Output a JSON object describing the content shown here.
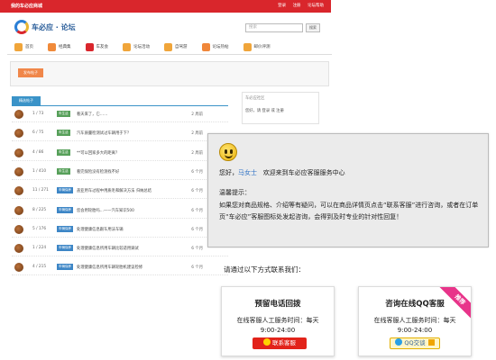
{
  "topbar": {
    "site_title": "我的车必应商城",
    "links": [
      "登录",
      "注册",
      "论坛帮助"
    ]
  },
  "logo": {
    "text": "车必应 · 论坛"
  },
  "search": {
    "placeholder": "搜索",
    "button": "搜索"
  },
  "nav": [
    {
      "label": "首页",
      "color": "#f0a53a"
    },
    {
      "label": "经典集",
      "color": "#f08a3a"
    },
    {
      "label": "车友会",
      "color": "#d9262c"
    },
    {
      "label": "论坛活动",
      "color": "#f0a53a"
    },
    {
      "label": "自驾游",
      "color": "#f0a53a"
    },
    {
      "label": "论坛热帖",
      "color": "#f0873a"
    },
    {
      "label": "邮价评测",
      "color": "#f0a53a"
    }
  ],
  "postbox": {
    "button": "发布帖子"
  },
  "list": {
    "header": "精选帖子",
    "rows": [
      {
        "count": "1 / 73",
        "tag": "车生活",
        "tag_color": "green",
        "title": "看天来了，它……",
        "date": "2 周前"
      },
      {
        "count": "6 / 75",
        "tag": "车生活",
        "tag_color": "green",
        "title": "汽车质量检测试过车辆用于下？",
        "date": "2 周前"
      },
      {
        "count": "4 / 86",
        "tag": "车生活",
        "tag_color": "green",
        "title": "**可以回家多大的距离？",
        "date": "2 周前"
      },
      {
        "count": "1 / 410",
        "tag": "车生活",
        "tag_color": "green",
        "title": "看完保险没有检测找不好",
        "date": "6 个月"
      },
      {
        "count": "11 / 271",
        "tag": "车辆保养",
        "tag_color": "blue",
        "title": "盖亚用车过程中用质毛和解决方法 归纳总结",
        "date": "6 个月"
      },
      {
        "count": "8 / 225",
        "tag": "车辆保养",
        "tag_color": "blue",
        "title": "您会用轮胎吗...——汽车知识500",
        "date": "6 个月"
      },
      {
        "count": "5 / 176",
        "tag": "车辆保养",
        "tag_color": "blue",
        "title": "处理健康信息跟车用法车辆",
        "date": "6 个月"
      },
      {
        "count": "1 / 224",
        "tag": "车辆保养",
        "tag_color": "blue",
        "title": "处理健康信息所用车辆比较适用调试",
        "date": "6 个月"
      },
      {
        "count": "4 / 215",
        "tag": "车辆保养",
        "tag_color": "blue",
        "title": "处理健康信息所用车辆轮胎机建议检修",
        "date": "6 个月"
      }
    ]
  },
  "sidebar": {
    "title": "车必应社区",
    "text": "您好，请 登录 或 注册"
  },
  "chat": {
    "greet_prefix": "您好，",
    "user_name": "马女士",
    "greet_suffix": "欢迎来到车必应客服服务中心",
    "tip_title": "温馨提示：",
    "tip_text": "如果您对商品规格、介绍等有疑问，可以在商品详情页点击“联系客服”进行咨询，或者在订单页“车必应”客服图标处发起咨询，会得到及时专业的针对性回复！"
  },
  "contact": {
    "title": "请通过以下方式联系我们：",
    "phone_card": {
      "heading": "预留电话回拨",
      "line": "在线客服人工服务时间：每天",
      "hours": "9:00-24:00",
      "button": "联系客服"
    },
    "qq_card": {
      "heading": "咨询在线QQ客服",
      "line": "在线客服人工服务时间：每天",
      "hours": "9:00-24:00",
      "button": "QQ交谈",
      "ribbon": "推荐"
    }
  }
}
